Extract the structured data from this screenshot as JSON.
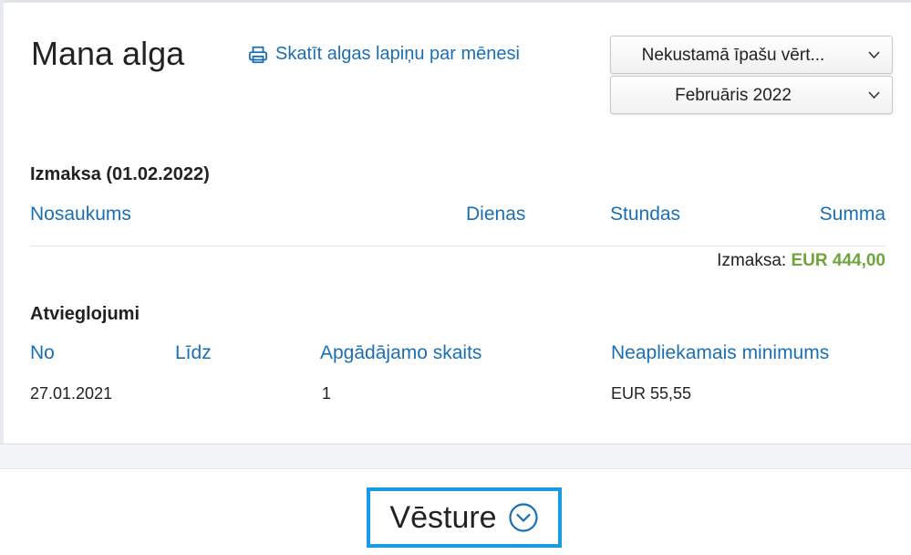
{
  "header": {
    "title": "Mana alga",
    "print_link": "Skatīt algas lapiņu par mēnesi"
  },
  "filters": {
    "category": "Nekustamā īpašu vērt...",
    "period": "Februāris 2022"
  },
  "payout": {
    "title": "Izmaksa (01.02.2022)",
    "columns": [
      "Nosaukums",
      "Dienas",
      "Stundas",
      "Summa"
    ],
    "total_label": "Izmaksa:",
    "total_value": "EUR 444,00"
  },
  "relief": {
    "title": "Atvieglojumi",
    "columns": [
      "No",
      "Līdz",
      "Apgādājamo skaits",
      "Neapliekamais minimums"
    ],
    "rows": [
      [
        "27.01.2021",
        "",
        "1",
        "EUR 55,55"
      ]
    ]
  },
  "history": {
    "label": "Vēsture"
  },
  "colors": {
    "link": "#1a6fb4",
    "amount": "#6ea63c",
    "highlight": "#1a9ae0"
  },
  "icons": {
    "print": "printer-icon",
    "dropdown": "chevron-down-icon",
    "history": "circle-chevron-down-icon"
  }
}
